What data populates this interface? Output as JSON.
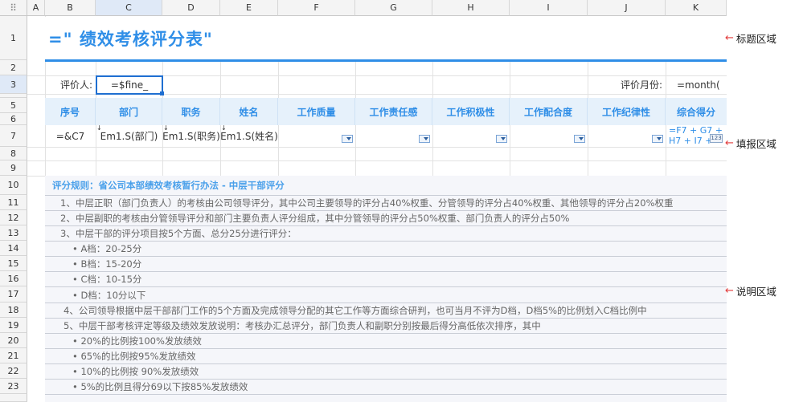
{
  "columns": [
    "A",
    "B",
    "C",
    "D",
    "E",
    "F",
    "G",
    "H",
    "I",
    "J",
    "K"
  ],
  "rows": [
    "1",
    "2",
    "3",
    "5",
    "6",
    "7",
    "8",
    "9",
    "10",
    "11",
    "12",
    "13",
    "14",
    "15",
    "16",
    "17",
    "18",
    "19",
    "20",
    "21",
    "22",
    "23"
  ],
  "title": "=\"  绩效考核评分表\"",
  "evaluator_label": "评价人:",
  "evaluator_formula": "=$fine_",
  "month_label": "评价月份:",
  "month_formula": "=month(",
  "headers": [
    "序号",
    "部门",
    "职务",
    "姓名",
    "工作质量",
    "工作责任感",
    "工作积极性",
    "工作配合度",
    "工作纪律性",
    "综合得分"
  ],
  "data_row": {
    "seq": "=&C7",
    "dept": "Em1.S(部门)",
    "post": "Em1.S(职务)",
    "name": "Em1.S(姓名)",
    "total_line1": "=F7 + G7 +",
    "total_line2": "H7 + I7 +",
    "total_badge": "123"
  },
  "description": [
    "评分规则：省公司本部绩效考核暂行办法 - 中层干部评分",
    "1、中层正职（部门负责人）的考核由公司领导评分，其中公司主要领导的评分占40%权重、分管领导的评分占40%权重、其他领导的评分占20%权重",
    "2、中层副职的考核由分管领导评分和部门主要负责人评分组成，其中分管领导的评分占50%权重、部门负责人的评分占50%",
    "3、中层干部的评分项目按5个方面、总分25分进行评分：",
    "• A档：20-25分",
    "• B档：15-20分",
    "• C档：10-15分",
    "• D档：10分以下",
    "4、公司领导根据中层干部部门工作的5个方面及完成领导分配的其它工作等方面综合研判，也可当月不评为D档，D档5%的比例划入C档比例中",
    "5、中层干部考核评定等级及绩效发放说明：考核办汇总评分，部门负责人和副职分别按最后得分高低依次排序，其中",
    "• 20%的比例按100%发放绩效",
    "• 65%的比例按95%发放绩效",
    "• 10%的比例按 90%发放绩效",
    "• 5%的比例且得分69以下按85%发放绩效"
  ],
  "annotations": {
    "title_region": "标题区域",
    "fill_region": "填报区域",
    "desc_region": "说明区域"
  }
}
